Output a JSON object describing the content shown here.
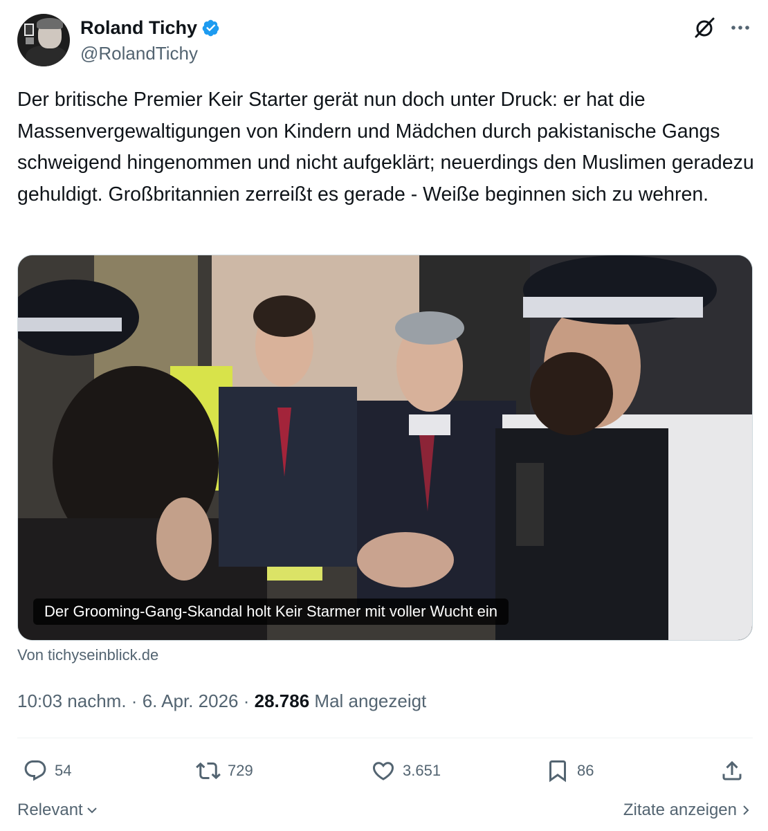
{
  "author": {
    "display_name": "Roland Tichy",
    "handle": "@RolandTichy",
    "verified": true
  },
  "header_icons": [
    "grok-icon",
    "more-icon"
  ],
  "tweet": {
    "text": "Der britische Premier Keir Starter gerät nun doch unter Druck: er hat die Massenvergewaltigungen von Kindern und Mädchen durch pakistanische Gangs schweigend hingenommen und nicht aufgeklärt; neuerdings den Muslimen geradezu gehuldigt. Großbritannien zerreißt es gerade - Weiße beginnen sich zu wehren."
  },
  "media": {
    "caption": "Der Grooming-Gang-Skandal holt Keir Starmer mit voller Wucht ein",
    "source": "Von tichyseinblick.de"
  },
  "meta": {
    "time": "10:03 nachm.",
    "separator": "·",
    "date": "6. Apr. 2026",
    "views_count": "28.786",
    "views_label": "Mal angezeigt"
  },
  "actions": {
    "replies": "54",
    "reposts": "729",
    "likes": "3.651",
    "bookmarks": "86"
  },
  "footer": {
    "sort_label": "Relevant",
    "quotes_label": "Zitate anzeigen"
  },
  "colors": {
    "text": "#0f1419",
    "secondary": "#536471",
    "verified": "#1d9bf0",
    "border": "#cfd9de"
  }
}
